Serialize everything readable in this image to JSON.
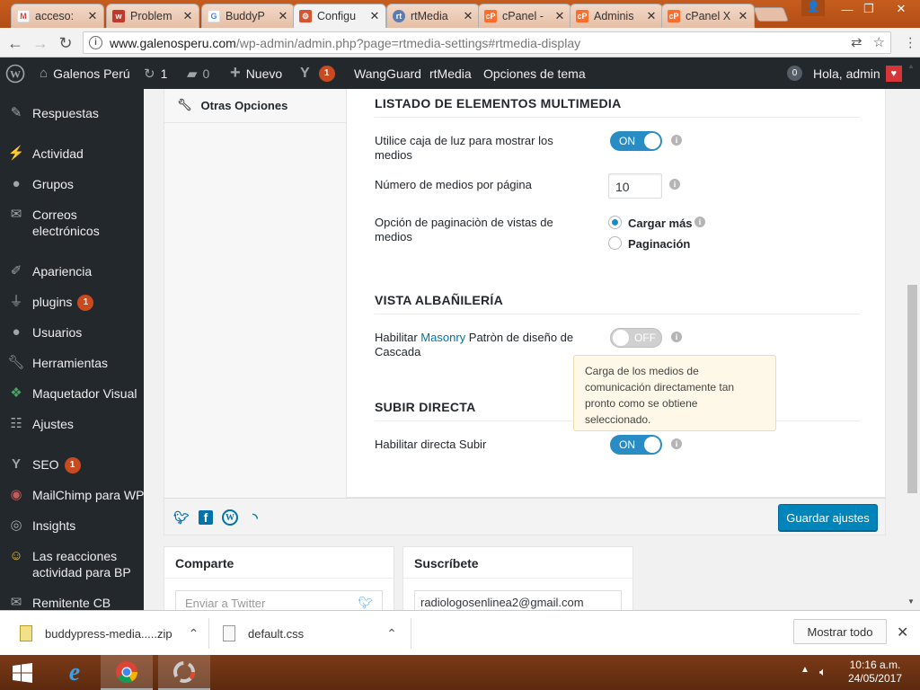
{
  "browser": {
    "tabs": [
      {
        "title": "acceso:",
        "favicon": "gmail-icon",
        "color": "#d44638",
        "letter": "M",
        "state": "inactive"
      },
      {
        "title": "Problem",
        "favicon": "wordfence-icon",
        "color": "#c0392b",
        "letter": "w",
        "state": "inactive"
      },
      {
        "title": "BuddyP",
        "favicon": "google-icon",
        "color": "#4285f4",
        "letter": "G",
        "state": "inactive"
      },
      {
        "title": "Configu",
        "favicon": "settings-icon",
        "color": "#d9532c",
        "letter": "⚙",
        "state": "active"
      },
      {
        "title": "rtMedia",
        "favicon": "rtmedia-icon",
        "color": "#5b7db1",
        "letter": "rt",
        "state": "inactive"
      },
      {
        "title": "cPanel -",
        "favicon": "cpanel-icon",
        "color": "#ff6c2c",
        "letter": "cP",
        "state": "inactive"
      },
      {
        "title": "Adminis",
        "favicon": "cpanel-icon",
        "color": "#ff6c2c",
        "letter": "cP",
        "state": "inactive"
      },
      {
        "title": "cPanel X",
        "favicon": "cpanel-icon",
        "color": "#ff6c2c",
        "letter": "cP",
        "state": "inactive"
      }
    ],
    "url_host": "www.galenosperu.com",
    "url_path": "/wp-admin/admin.php?page=rtmedia-settings#rtmedia-display"
  },
  "adminbar": {
    "site_name": "Galenos Perú",
    "updates_count": "1",
    "comments_count": "0",
    "new_label": "Nuevo",
    "yoast_badge": "1",
    "wangguard_label": "WangGuard",
    "rtmedia_label": "rtMedia",
    "theme_options_label": "Opciones de tema",
    "notif_count": "0",
    "greeting": "Hola, admin"
  },
  "sidemenu": [
    {
      "label": "Respuestas",
      "icon": "replies-icon",
      "badge": ""
    },
    {
      "label": "Actividad",
      "icon": "activity-icon",
      "badge": ""
    },
    {
      "label": "Grupos",
      "icon": "groups-icon",
      "badge": ""
    },
    {
      "label": "Correos electrónicos",
      "icon": "email-icon",
      "badge": ""
    },
    {
      "label": "Apariencia",
      "icon": "appearance-icon",
      "badge": ""
    },
    {
      "label": "plugins",
      "icon": "plugins-icon",
      "badge": "1"
    },
    {
      "label": "Usuarios",
      "icon": "users-icon",
      "badge": ""
    },
    {
      "label": "Herramientas",
      "icon": "tools-icon",
      "badge": ""
    },
    {
      "label": "Maquetador Visual",
      "icon": "visual-builder-icon",
      "badge": ""
    },
    {
      "label": "Ajustes",
      "icon": "settings-icon",
      "badge": ""
    },
    {
      "label": "SEO",
      "icon": "yoast-icon",
      "badge": "1"
    },
    {
      "label": "MailChimp para WP",
      "icon": "mailchimp-icon",
      "badge": ""
    },
    {
      "label": "Insights",
      "icon": "insights-icon",
      "badge": ""
    },
    {
      "label": "Las reacciones actividad para BP",
      "icon": "reactions-icon",
      "badge": ""
    },
    {
      "label": "Remitente CB",
      "icon": "mail-icon",
      "badge": ""
    }
  ],
  "settings": {
    "nav_other_options": "Otras Opciones",
    "section_media_list": "LISTADO DE ELEMENTOS MULTIMEDIA",
    "lightbox_label": "Utilice caja de luz para mostrar los medios",
    "lightbox_toggle": "ON",
    "per_page_label": "Número de medios por página",
    "per_page_value": "10",
    "pagination_label": "Opción de paginaciòn de vistas de medios",
    "radio_load_more": "Cargar más",
    "radio_pagination": "Paginación",
    "section_masonry": "VISTA ALBAÑILERÍA",
    "masonry_label_pre": "Habilitar ",
    "masonry_label_link": "Masonry",
    "masonry_label_post": " Patròn de diseño de Cascada",
    "masonry_toggle": "OFF",
    "tooltip_text": "Carga de los medios de comunicación directamente tan pronto como se obtiene seleccionado.",
    "section_direct_upload": "SUBIR DIRECTA",
    "direct_upload_label": "Habilitar directa Subir",
    "direct_upload_toggle": "ON",
    "save_button": "Guardar ajustes"
  },
  "widgets": {
    "share_title": "Comparte",
    "share_placeholder": "Enviar a Twitter",
    "subscribe_title": "Suscríbete",
    "subscribe_value": "radiologosenlinea2@gmail.com"
  },
  "downloads": {
    "file1": "buddypress-media.....zip",
    "file2": "default.css",
    "show_all": "Mostrar todo"
  },
  "taskbar": {
    "time": "10:16 a.m.",
    "date": "24/05/2017"
  },
  "colors": {
    "wp_blue": "#0085ba",
    "admin_dark": "#23282d",
    "badge_orange": "#ca4a1f",
    "toggle_on": "#2a8cc5"
  }
}
